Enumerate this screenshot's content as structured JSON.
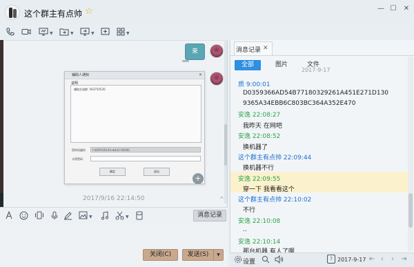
{
  "window": {
    "title": "这个群主有点帅",
    "star_icon": "star-icon",
    "controls": [
      "minimize",
      "maximize",
      "close"
    ]
  },
  "toolbar_icons": [
    "phone-icon",
    "video-icon",
    "screen-share-icon",
    "file-transfer-icon",
    "remote-desktop-icon",
    "add-icon",
    "apps-grid-icon"
  ],
  "chat": {
    "bubble_text": "来",
    "screenshot": {
      "title": "辅助人通知",
      "group_label": "说明",
      "panel_text": "辅助交流群: 563750530",
      "field1_label": "您的机器码",
      "field1_value": "f-d4f0f-6614f-ab4e2-00000",
      "field2_label": "卡密密码",
      "ok_label": "确定",
      "cancel_label": "退出"
    },
    "timestamp": "2017/9/16 22:14:50"
  },
  "input_toolbar": {
    "icons": [
      "font-icon",
      "emoji-icon",
      "shake-icon",
      "voice-icon",
      "handwriting-icon",
      "image-icon",
      "music-icon",
      "screenshot-icon",
      "red-packet-icon"
    ],
    "history_button_label": "消息记录"
  },
  "input_area": {
    "close_label": "关闭(C)",
    "send_label": "发送(S)"
  },
  "history": {
    "tab_label": "消息记录",
    "filters": [
      "全部",
      "图片",
      "文件"
    ],
    "top_date": "2017-9-17",
    "messages": [
      {
        "sender": "质 9:00:01",
        "sender_color": "#1a6fd1",
        "lines": [
          "D0359366AD54B77180329261A451E271D130",
          "9365A34EBB6C803BC364A352E470"
        ]
      },
      {
        "sender": "安逸 22:08:27",
        "sender_color": "#2aa34a",
        "lines": [
          "我昨天 在网吧"
        ]
      },
      {
        "sender": "安逸 22:08:52",
        "sender_color": "#2aa34a",
        "lines": [
          "换机器了"
        ]
      },
      {
        "sender": "这个群主有点帅 22:09:44",
        "sender_color": "#1a6fd1",
        "lines": [
          "换机器不行"
        ]
      },
      {
        "sender": "安逸 22:09:55",
        "sender_color": "#2aa34a",
        "lines": [
          "穿一下 我看看这个"
        ]
      },
      {
        "sender": "这个群主有点帅 22:10:02",
        "sender_color": "#1a6fd1",
        "lines": [
          "不行"
        ]
      },
      {
        "sender": "安逸 22:10:08",
        "sender_color": "#2aa34a",
        "lines": [
          ".."
        ]
      },
      {
        "sender": "安逸 22:10:14",
        "sender_color": "#2aa34a",
        "lines": [
          "那台机器 有人了啊"
        ]
      }
    ],
    "footer": {
      "settings_label": "设置",
      "date": "2017-9-17"
    }
  }
}
